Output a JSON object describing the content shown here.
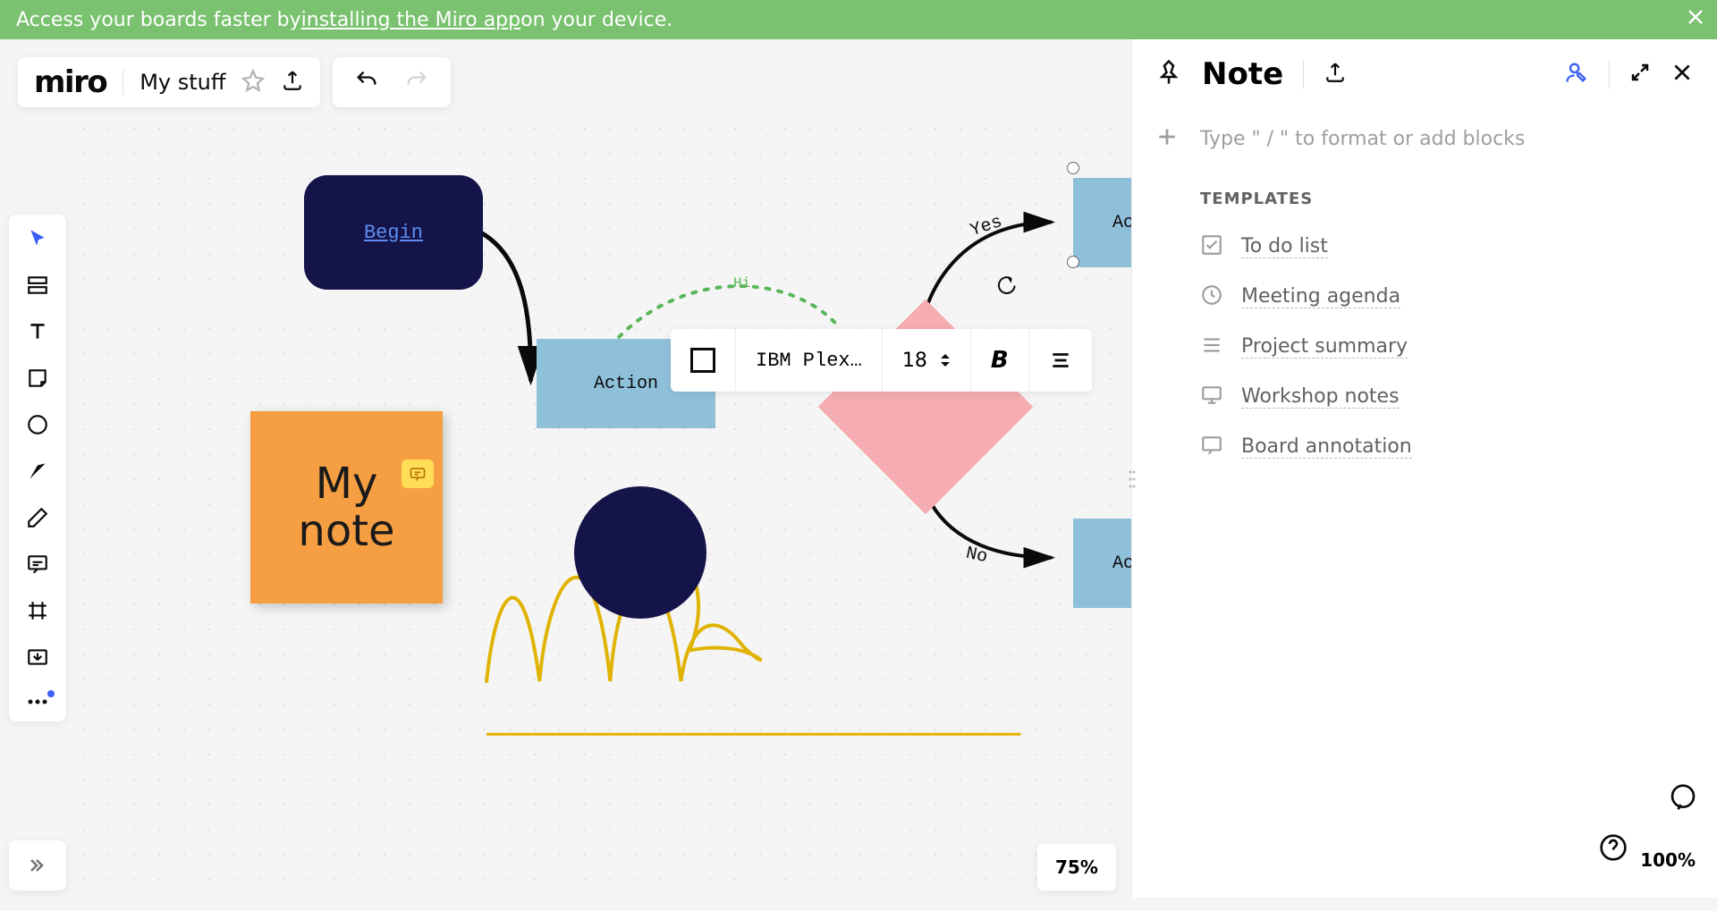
{
  "banner": {
    "text_before": "Access your boards faster by ",
    "link": "installing the Miro app",
    "text_after": " on your device."
  },
  "header": {
    "logo": "miro",
    "board_name": "My stuff",
    "share_label": "Share"
  },
  "text_toolbar": {
    "font": "IBM Plex…",
    "size": "18"
  },
  "canvas": {
    "begin": "Begin",
    "action1": "Action",
    "action2": "Act",
    "action3": "Act",
    "sticky_line1": "My",
    "sticky_line2": "note",
    "yes": "Yes",
    "no": "No",
    "hi": "Hi"
  },
  "zoom": {
    "main": "75%",
    "panel": "100%"
  },
  "note": {
    "title": "Note",
    "placeholder": "Type \" / \" to format or add blocks",
    "templates_label": "TEMPLATES",
    "templates": {
      "t0": "To do list",
      "t1": "Meeting agenda",
      "t2": "Project summary",
      "t3": "Workshop notes",
      "t4": "Board annotation"
    }
  }
}
